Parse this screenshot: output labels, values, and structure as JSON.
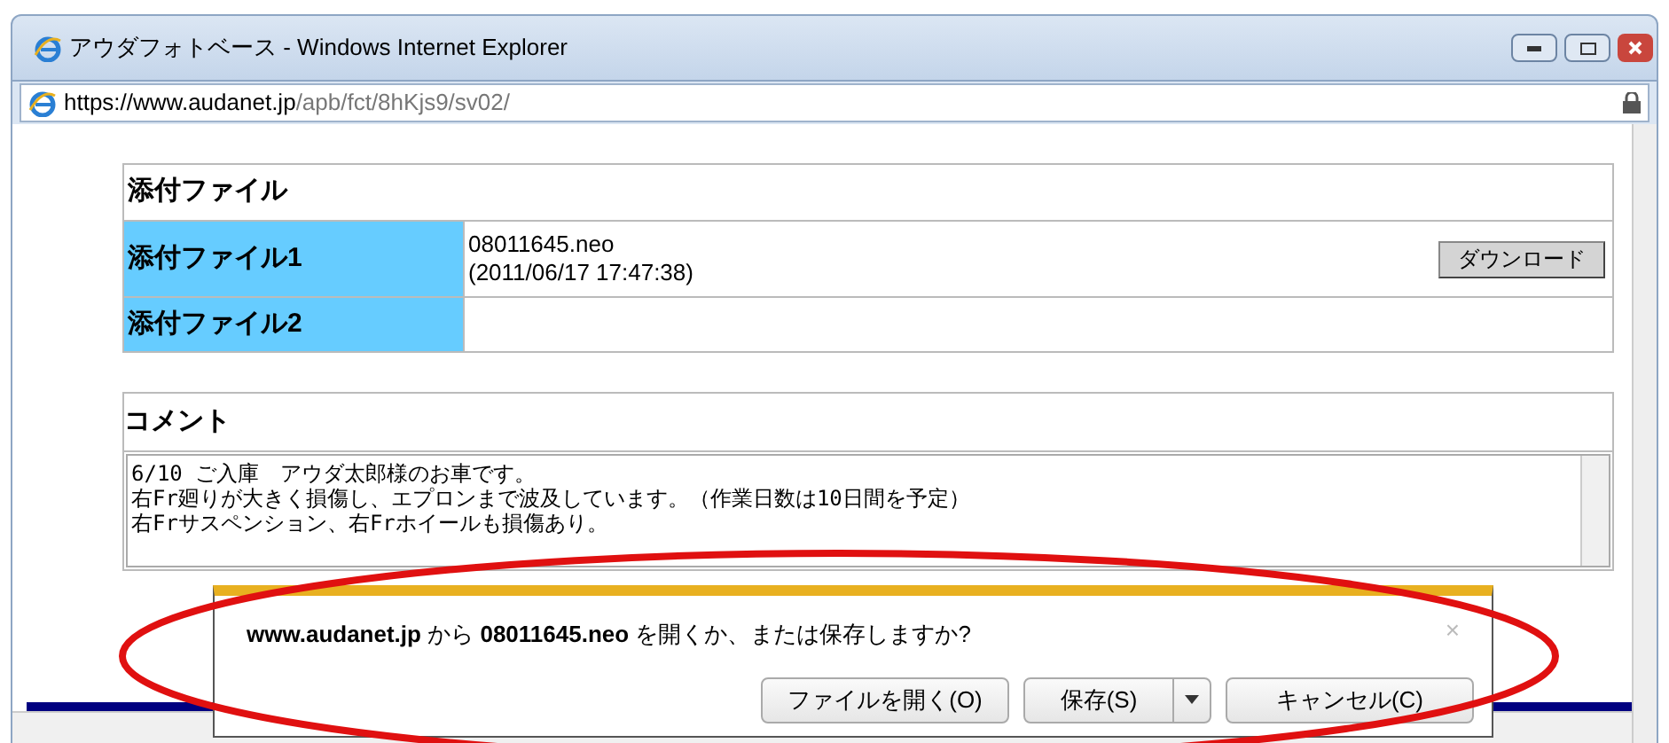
{
  "window": {
    "title": "アウダフォトベース - Windows Internet Explorer"
  },
  "address_bar": {
    "url_host": "https://www.audanet.jp",
    "url_path": "/apb/fct/8hKjs9/sv02/"
  },
  "attachments": {
    "heading": "添付ファイル",
    "rows": [
      {
        "label": "添付ファイル1",
        "file": "08011645.neo",
        "date": "(2011/06/17 17:47:38)",
        "button": "ダウンロード"
      },
      {
        "label": "添付ファイル2"
      }
    ]
  },
  "comment": {
    "heading": "コメント",
    "lines": [
      "6/10 ご入庫　アウダ太郎様のお車です。",
      "右Fr廻りが大きく損傷し、エプロンまで波及しています。（作業日数は10日間を予定）",
      "右Frサスペンション、右Frホイールも損傷あり。"
    ]
  },
  "download_bar": {
    "message": "**www.audanet.jp** から **08011645.neo** を開くか、または保存しますか?",
    "close": "×",
    "buttons": [
      {
        "kind": "plain",
        "label": "ファイルを開く(O)"
      },
      {
        "kind": "split",
        "label": "保存(S)"
      },
      {
        "kind": "plain",
        "label": "キャンセル(C)"
      }
    ]
  }
}
